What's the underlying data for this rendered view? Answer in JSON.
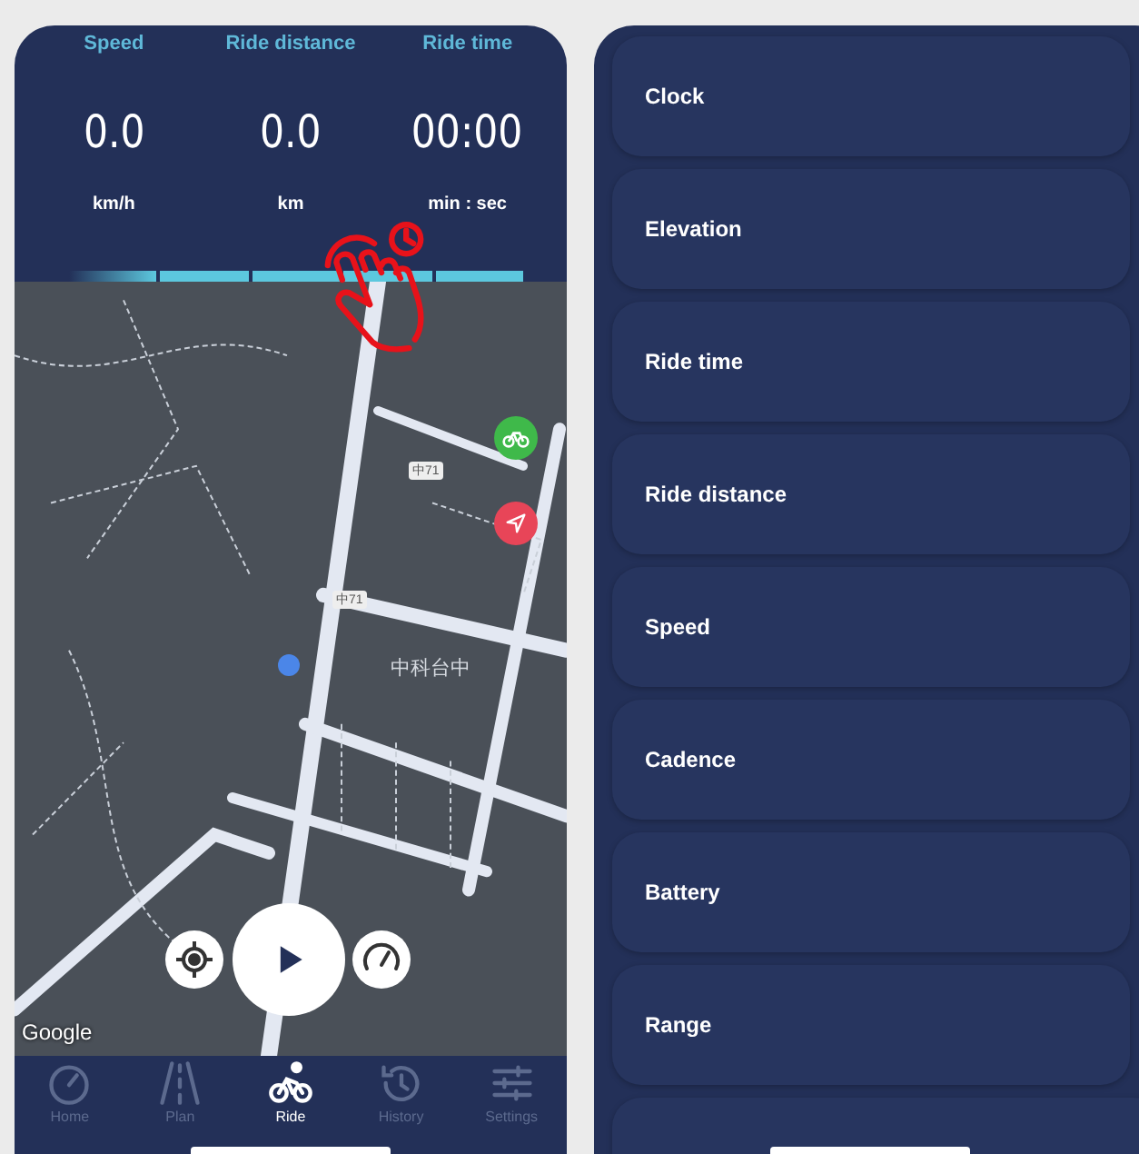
{
  "stats": [
    {
      "label": "Speed",
      "value": "0.0",
      "unit": "km/h"
    },
    {
      "label": "Ride distance",
      "value": "0.0",
      "unit": "km"
    },
    {
      "label": "Ride time",
      "value": "00:00",
      "unit": "min : sec"
    }
  ],
  "map": {
    "labels": [
      {
        "text": "中71",
        "kind": "shield"
      },
      {
        "text": "中71",
        "kind": "shield"
      },
      {
        "text": "中科台中",
        "kind": "place"
      }
    ],
    "attribution": "Google"
  },
  "nav": [
    {
      "label": "Home",
      "selected": false
    },
    {
      "label": "Plan",
      "selected": false
    },
    {
      "label": "Ride",
      "selected": true
    },
    {
      "label": "History",
      "selected": false
    },
    {
      "label": "Settings",
      "selected": false
    }
  ],
  "fields": [
    "Clock",
    "Elevation",
    "Ride time",
    "Ride distance",
    "Speed",
    "Cadence",
    "Battery",
    "Range"
  ]
}
